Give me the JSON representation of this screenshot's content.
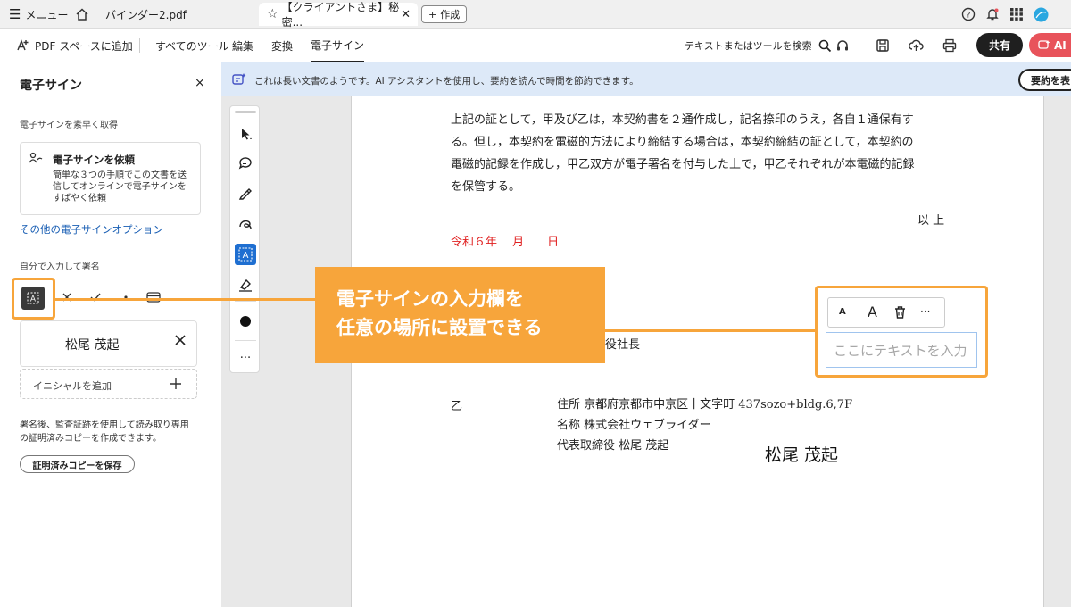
{
  "tabbar": {
    "menu_label": "メニュー",
    "tab1_title": "バインダー2.pdf",
    "tab2_title": "【クライアントさま】秘密...",
    "new_label": "作成"
  },
  "toolbar": {
    "add_to_space": "PDF スペースに追加",
    "nav": [
      "すべてのツール",
      "編集",
      "変換",
      "電子サイン"
    ],
    "search_label": "テキストまたはツールを検索",
    "share_label": "共有",
    "ai_label": "AI"
  },
  "left_panel": {
    "title": "電子サイン",
    "close_label": "×",
    "section1_label": "電子サインを素早く取得",
    "request_title": "電子サインを依頼",
    "request_desc_lines": [
      "簡単な３つの手順でこの文書を送",
      "信してオンラインで電子サインを",
      "すばやく依頼"
    ],
    "other_options_link": "その他の電子サインオプション",
    "self_sign_label": "自分で入力して署名",
    "signature_name": "松尾 茂起",
    "initials_placeholder": "イニシャルを追加",
    "info_lines": [
      "署名後、監査証跡を使用して読み取り専用",
      "の証明済みコピーを作成できます。"
    ],
    "save_button": "証明済みコピーを保存"
  },
  "banner": {
    "text": "これは長い文書のようです。AI アシスタントを使用し、要約を読んで時間を節約できます。",
    "summary_button": "要約を表"
  },
  "document": {
    "paragraph_lines": [
      "上記の証として，甲及び乙は，本契約書を２通作成し，記名捺印のうえ，各自１通保有す",
      "る。但し，本契約を電磁的方法により締結する場合は，本契約締結の証として，本契約の",
      "電磁的記録を作成し，甲乙双方が電子署名を付与した上で，甲乙それぞれが本電磁的記録",
      "を保管する。"
    ],
    "closing": "以 上",
    "date_line": "令和６年　 月　　日",
    "partial_title": "役社長",
    "party_label": "乙",
    "party_lines": [
      "住所 京都府京都市中京区十文字町 437sozo+bldg.6,7F",
      "名称 株式会社ウェブライダー",
      "代表取締役 松尾 茂起"
    ],
    "placed_signature": "松尾 茂起"
  },
  "text_field": {
    "placeholder": "ここにテキストを入力",
    "small_a": "A",
    "large_a": "A",
    "more": "···"
  },
  "annotation": {
    "lines": [
      "電子サインの入力欄を",
      "任意の場所に設置できる"
    ],
    "accent_color": "#f7a53b"
  },
  "vertical_tools": {
    "more": "···"
  }
}
